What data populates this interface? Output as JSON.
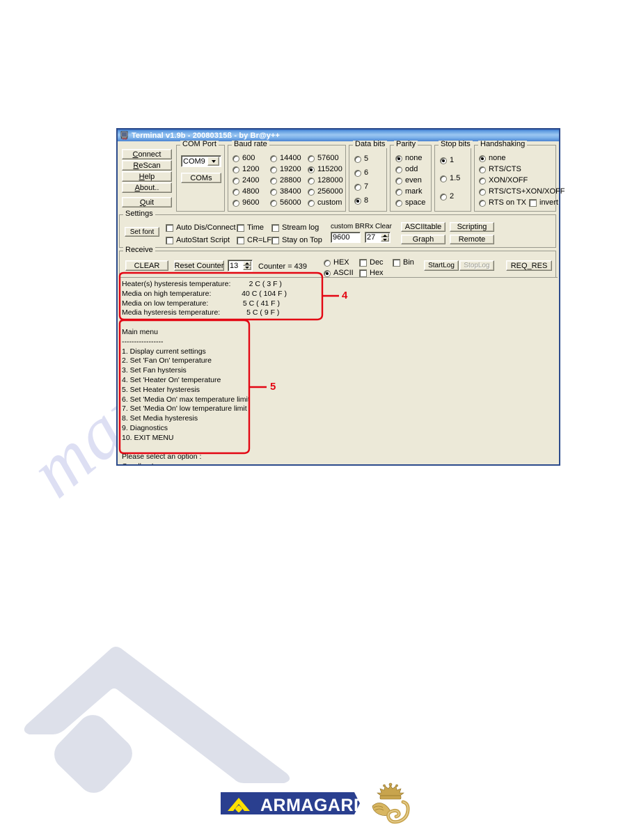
{
  "watermark": {
    "diagonal_text": "manualshive.com"
  },
  "window": {
    "title": "Terminal v1.9b - 20080315ß - by Br@y++",
    "icon": "terminal-app-icon"
  },
  "actions": {
    "connect": "Connect",
    "rescan": "ReScan",
    "help": "Help",
    "about": "About..",
    "quit": "Quit"
  },
  "com_port": {
    "legend": "COM Port",
    "selected": "COM9",
    "coms_button": "COMs"
  },
  "baud_rate": {
    "legend": "Baud rate",
    "selected": "115200",
    "col1": [
      "600",
      "1200",
      "2400",
      "4800",
      "9600"
    ],
    "col2": [
      "14400",
      "19200",
      "28800",
      "38400",
      "56000"
    ],
    "col3": [
      "57600",
      "115200",
      "128000",
      "256000",
      "custom"
    ]
  },
  "data_bits": {
    "legend": "Data bits",
    "selected": "8",
    "options": [
      "5",
      "6",
      "7",
      "8"
    ]
  },
  "parity": {
    "legend": "Parity",
    "selected": "none",
    "options": [
      "none",
      "odd",
      "even",
      "mark",
      "space"
    ]
  },
  "stop_bits": {
    "legend": "Stop bits",
    "selected": "1",
    "options": [
      "1",
      "1.5",
      "2"
    ]
  },
  "handshaking": {
    "legend": "Handshaking",
    "selected": "none",
    "options": [
      "none",
      "RTS/CTS",
      "XON/XOFF",
      "RTS/CTS+XON/XOFF",
      "RTS on TX"
    ],
    "invert_label": "invert",
    "invert_checked": false
  },
  "settings": {
    "legend": "Settings",
    "set_font": "Set font",
    "checkboxes": [
      {
        "label": "Auto Dis/Connect",
        "checked": false
      },
      {
        "label": "AutoStart Script",
        "checked": false
      },
      {
        "label": "Time",
        "checked": false
      },
      {
        "label": "CR=LF",
        "checked": false
      },
      {
        "label": "Stream log",
        "checked": false
      },
      {
        "label": "Stay on Top",
        "checked": false
      }
    ],
    "custom_br_label": "custom BR",
    "custom_br_value": "9600",
    "rx_clear_label": "Rx Clear",
    "rx_clear_value": "27",
    "ascii_table": "ASCIItable",
    "scripting": "Scripting",
    "graph": "Graph",
    "remote": "Remote"
  },
  "receive": {
    "legend": "Receive",
    "clear": "CLEAR",
    "reset_counter": "Reset Counter",
    "counter_field": "13",
    "counter_text": "Counter = 439",
    "hex_radio": "HEX",
    "ascii_radio": "ASCII",
    "selected_radio": "ASCII",
    "dec_check": "Dec",
    "hex_check": "Hex",
    "bin_check": "Bin",
    "start_log": "StartLog",
    "stop_log": "StopLog",
    "stop_log_disabled": true,
    "req_res": "REQ_RES"
  },
  "terminal_output": {
    "settings_block": [
      "Heater(s) hysteresis temperature:         2 C ( 3 F )",
      "Media on high temperature:               40 C ( 104 F )",
      "Media on low temperature:                 5 C ( 41 F )",
      "Media hysteresis temperature:             5 C ( 9 F )"
    ],
    "menu_block": [
      "",
      "Main menu",
      "-----------------",
      "1. Display current settings",
      "2. Set 'Fan On' temperature",
      "3. Set Fan hystersis",
      "4. Set 'Heater On' temperature",
      "5. Set Heater hysteresis",
      "6. Set 'Media On' max temperature limit",
      "7. Set 'Media On' low temperature limit",
      "8. Set Media hysteresis",
      "9. Diagnostics",
      "10. EXIT MENU",
      "",
      "Please select an option :",
      "Goodbye!"
    ]
  },
  "annotations": {
    "callout_4": "4",
    "callout_5": "5",
    "color": "#e30613"
  },
  "footer": {
    "brand": "ARMAGARD",
    "brand_badge_color": "#2a3f8f",
    "brand_accent_color": "#ffe200",
    "crest": "queens-award-crest"
  }
}
